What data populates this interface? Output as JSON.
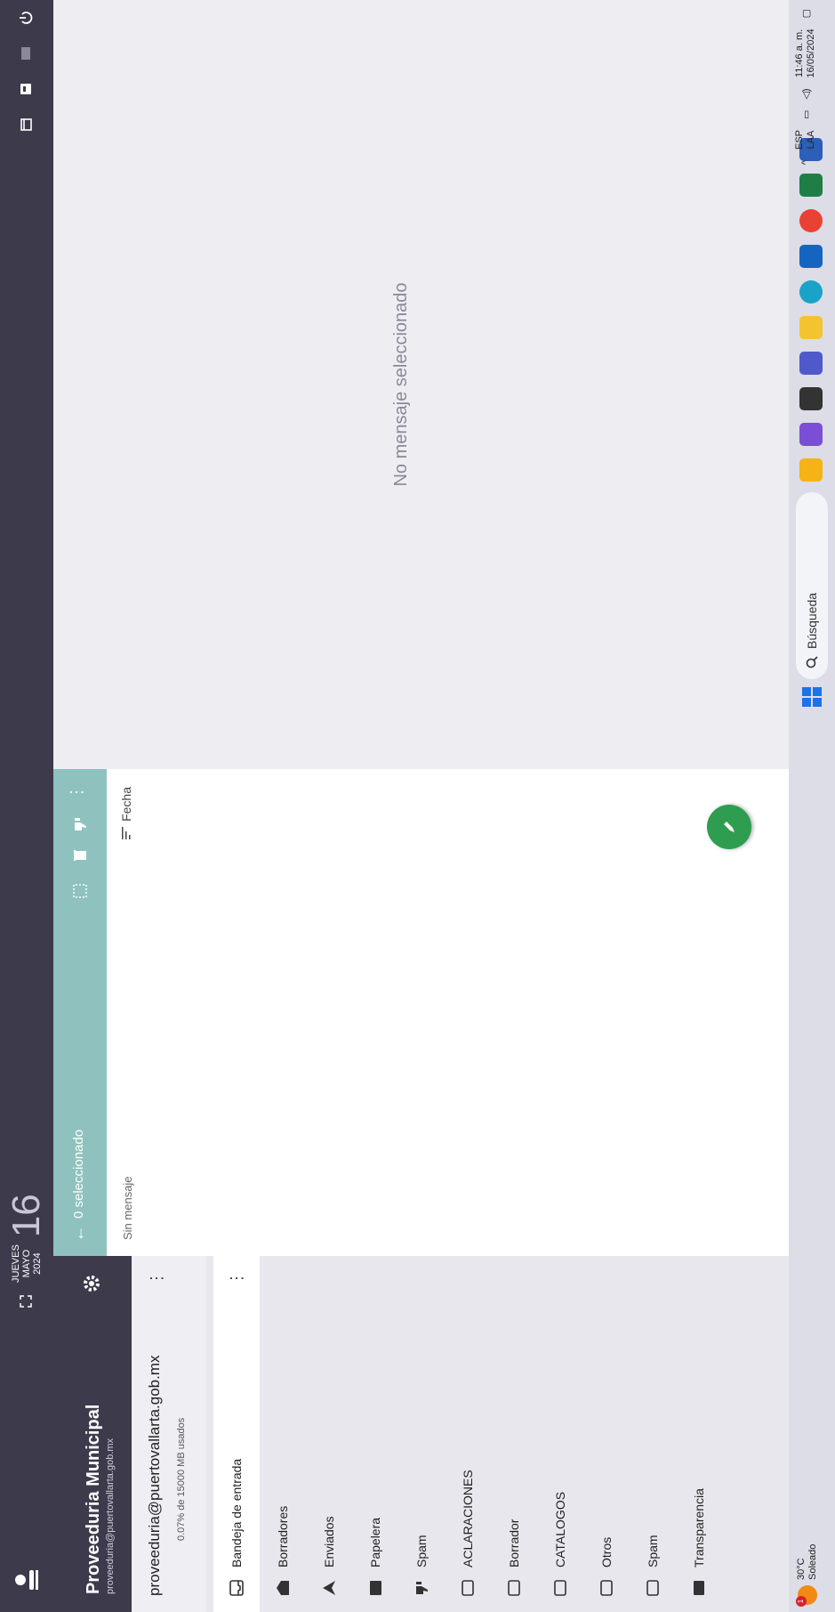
{
  "header": {
    "date": {
      "weekday": "JUEVES",
      "month": "MAYO",
      "year": "2024",
      "day": "16"
    }
  },
  "account": {
    "name": "Proveeduria Municipal",
    "email_small": "proveeduria@puertovallarta.gob.mx",
    "address": "proveeduria@puertovallarta.gob.mx",
    "usage": "0.07% de 15000 MB usados"
  },
  "folders": [
    {
      "label": "Bandeja de entrada",
      "icon": "inbox-icon"
    },
    {
      "label": "Borradores",
      "icon": "drafts-icon"
    },
    {
      "label": "Enviados",
      "icon": "send-icon"
    },
    {
      "label": "Papelera",
      "icon": "trash-folder-icon"
    },
    {
      "label": "Spam",
      "icon": "spam-icon"
    },
    {
      "label": "ACLARACIONES",
      "icon": "folder-icon"
    },
    {
      "label": "Borrador",
      "icon": "folder-icon"
    },
    {
      "label": "CATALOGOS",
      "icon": "folder-icon"
    },
    {
      "label": "Otros",
      "icon": "folder-icon"
    },
    {
      "label": "Spam",
      "icon": "folder-icon"
    },
    {
      "label": "Transparencia",
      "icon": "folder-filled-icon"
    }
  ],
  "list": {
    "selection": "0 seleccionado",
    "empty": "Sin mensaje",
    "sort_label": "Fecha"
  },
  "view": {
    "empty": "No mensaje seleccionado"
  },
  "taskbar": {
    "temperature": "30°C",
    "weather": "Soleado",
    "search_placeholder": "Búsqueda",
    "language": "ESP",
    "layout": "LAA",
    "time": "11:46 a. m.",
    "date": "16/05/2024"
  },
  "colors": {
    "topbar": "#3d3a4b",
    "toolbar_accent": "#8fc2bf",
    "compose": "#2e9d4f"
  }
}
